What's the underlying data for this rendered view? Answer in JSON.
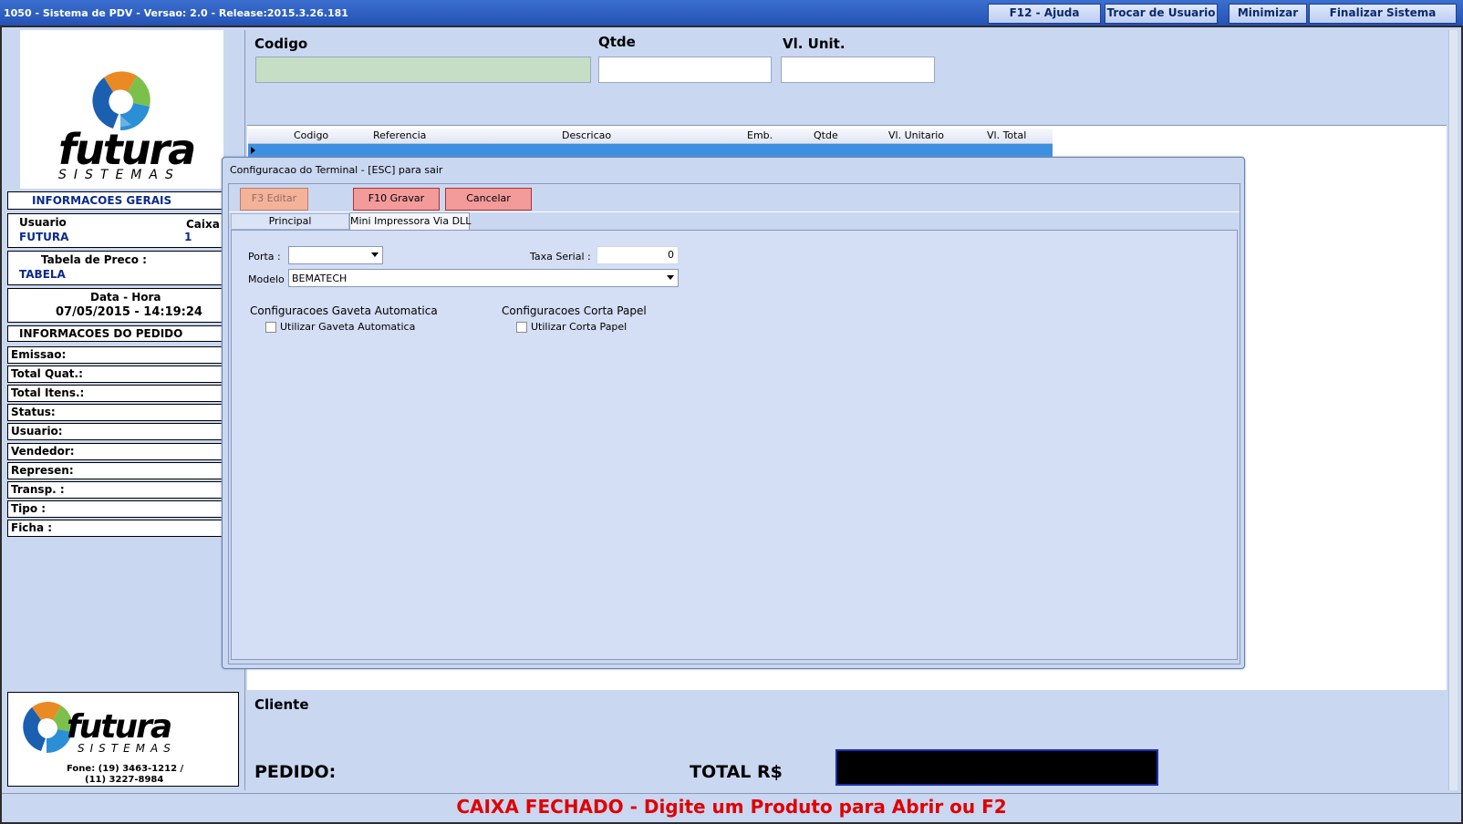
{
  "window": {
    "title": "1050 - Sistema de PDV - Versao: 2.0 - Release:2015.3.26.181",
    "buttons": {
      "help": "F12 - Ajuda",
      "switch_user": "Trocar de Usuario",
      "minimize": "Minimizar",
      "exit": "Finalizar Sistema"
    }
  },
  "brand": {
    "name": "futura",
    "sub": "SISTEMAS",
    "phone1": "Fone: (19) 3463-1212 /",
    "phone2": "(11) 3227-8984"
  },
  "general": {
    "header": "INFORMACOES GERAIS",
    "user_label": "Usuario",
    "user_value": "FUTURA",
    "caixa_label": "Caixa",
    "caixa_value": "1",
    "price_table_label": "Tabela de Preco :",
    "price_table_value": "TABELA",
    "datetime_label": "Data - Hora",
    "datetime_value": "07/05/2015 - 14:19:24"
  },
  "order": {
    "header": "INFORMACOES DO PEDIDO",
    "fields": [
      "Emissao:",
      "Total Quat.:",
      "Total Itens.:",
      "Status:",
      "Usuario:",
      "Vendedor:",
      "Represen:",
      "Transp. :",
      "Tipo :",
      "Ficha :"
    ]
  },
  "entry": {
    "codigo": "Codigo",
    "qtde": "Qtde",
    "vl_unit": "Vl. Unit."
  },
  "grid": {
    "columns": [
      "Codigo",
      "Referencia",
      "Descricao",
      "Emb.",
      "Qtde",
      "Vl. Unitario",
      "Vl. Total"
    ]
  },
  "dialog": {
    "title": "Configuracao do Terminal - [ESC] para sair",
    "btn_edit": "F3 Editar",
    "btn_save": "F10 Gravar",
    "btn_cancel": "Cancelar",
    "tabs": [
      "Principal",
      "Mini Impressora Via DLL"
    ],
    "porta_label": "Porta :",
    "porta_value": "",
    "taxa_label": "Taxa Serial :",
    "taxa_value": "0",
    "modelo_label": "Modelo :",
    "modelo_value": "BEMATECH",
    "gaveta_header": "Configuracoes Gaveta Automatica",
    "gaveta_check": "Utilizar Gaveta Automatica",
    "corta_header": "Configuracoes Corta Papel",
    "corta_check": "Utilizar Corta Papel"
  },
  "footer": {
    "cliente": "Cliente",
    "pedido": "PEDIDO:",
    "total": "TOTAL R$",
    "status": "CAIXA FECHADO - Digite um Produto para Abrir ou F2",
    "status_color": "#e00000"
  }
}
